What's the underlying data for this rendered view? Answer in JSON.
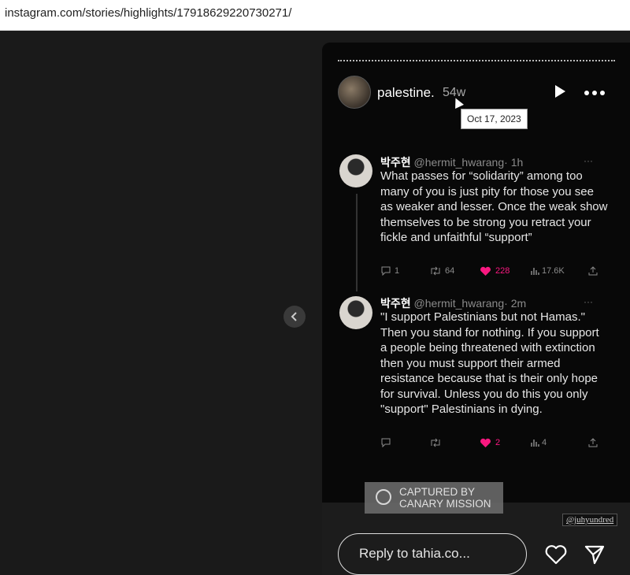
{
  "browser": {
    "url": "instagram.com/stories/highlights/17918629220730271/"
  },
  "story": {
    "username": "palestine.",
    "time_ago": "54w",
    "tooltip_date": "Oct 17, 2023",
    "reply_placeholder": "Reply to tahia.co...",
    "handle_badge": "@juhyundred",
    "watermark": {
      "line1": "CAPTURED BY",
      "line2": "CANARY MISSION"
    }
  },
  "tweets": [
    {
      "name": "박주현",
      "handle": "@hermit_hwarang",
      "time": "· 1h",
      "more": "···",
      "text": "What passes for “solidarity” among too many of you is just pity for those you see as weaker and lesser. Once the weak show themselves to be strong you retract your fickle and unfaithful “support”",
      "replies": "1",
      "retweets": "64",
      "likes": "228",
      "views": "17.6K"
    },
    {
      "name": "박주현",
      "handle": "@hermit_hwarang",
      "time": "· 2m",
      "more": "···",
      "text": "\"I support Palestinians but not Hamas.\" Then you stand for nothing. If you support a people being threatened with extinction then you must support their armed resistance because that is their only hope for survival. Unless you do this you only \"support\" Palestinians in dying.",
      "replies": "",
      "retweets": "",
      "likes": "2",
      "views": "4"
    }
  ],
  "colors": {
    "like_pink": "#f91880",
    "story_bg": "#080808",
    "page_bg": "#1a1a1a"
  },
  "icons": [
    "chevron-left-icon",
    "play-icon",
    "more-icon",
    "reply-icon",
    "retweet-icon",
    "heart-icon",
    "views-icon",
    "share-icon",
    "canary-logo-icon",
    "like-icon",
    "send-icon"
  ]
}
